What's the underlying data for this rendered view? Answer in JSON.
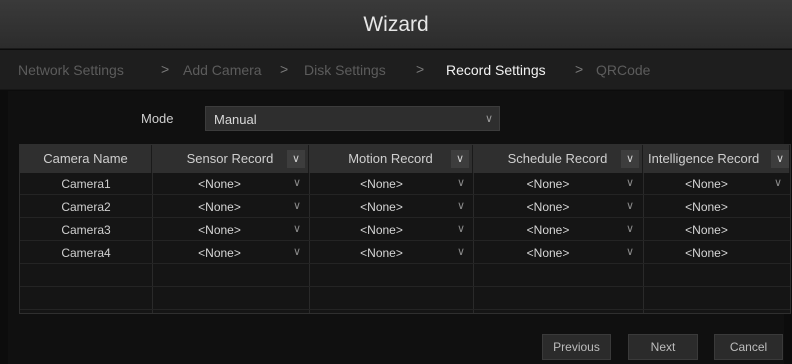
{
  "window": {
    "title": "Wizard"
  },
  "steps": [
    {
      "label": "Network Settings",
      "active": false
    },
    {
      "label": "Add Camera",
      "active": false
    },
    {
      "label": "Disk Settings",
      "active": false
    },
    {
      "label": "Record Settings",
      "active": true
    },
    {
      "label": "QRCode",
      "active": false
    }
  ],
  "step_separator": ">",
  "mode": {
    "label": "Mode",
    "value": "Manual"
  },
  "table": {
    "columns": [
      "Camera Name",
      "Sensor Record",
      "Motion Record",
      "Schedule Record",
      "Intelligence Record"
    ],
    "rows": [
      {
        "camera": "Camera1",
        "sensor": "<None>",
        "motion": "<None>",
        "schedule": "<None>",
        "intelligence": "<None>"
      },
      {
        "camera": "Camera2",
        "sensor": "<None>",
        "motion": "<None>",
        "schedule": "<None>",
        "intelligence": "<None>"
      },
      {
        "camera": "Camera3",
        "sensor": "<None>",
        "motion": "<None>",
        "schedule": "<None>",
        "intelligence": "<None>"
      },
      {
        "camera": "Camera4",
        "sensor": "<None>",
        "motion": "<None>",
        "schedule": "<None>",
        "intelligence": "<None>"
      }
    ]
  },
  "buttons": {
    "previous": "Previous",
    "next": "Next",
    "cancel": "Cancel"
  },
  "colors": {
    "background": "#0c0c0c",
    "header": "#2f2f2f",
    "active_step": "#f2f2f2",
    "inactive_step": "#5c5c5c"
  }
}
